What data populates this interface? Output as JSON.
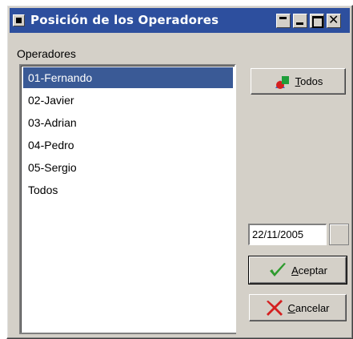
{
  "window": {
    "title": "Posición de los Operadores"
  },
  "operators": {
    "label": "Operadores",
    "items": [
      {
        "label": "01-Fernando",
        "selected": true
      },
      {
        "label": "02-Javier",
        "selected": false
      },
      {
        "label": "03-Adrian",
        "selected": false
      },
      {
        "label": "04-Pedro",
        "selected": false
      },
      {
        "label": "05-Sergio",
        "selected": false
      },
      {
        "label": "Todos",
        "selected": false
      }
    ]
  },
  "buttons": {
    "todos": {
      "label_first": "T",
      "label_rest": "odos",
      "icon": "shapes-icon"
    },
    "aceptar": {
      "label_first": "A",
      "label_rest": "ceptar",
      "icon": "checkmark-icon"
    },
    "cancelar": {
      "label_first": "C",
      "label_rest": "ancelar",
      "icon": "x-icon"
    }
  },
  "date": {
    "value": "22/11/2005"
  },
  "colors": {
    "titlebar": "#2d4f9e",
    "selection": "#3a5a96",
    "face": "#d4d0c8",
    "check_green": "#2e9b2e",
    "cancel_red": "#d42020"
  }
}
